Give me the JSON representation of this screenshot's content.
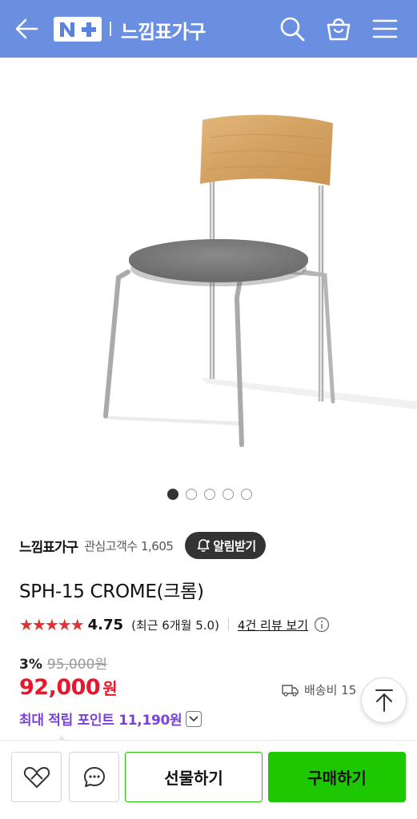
{
  "header": {
    "logo_text": "N+",
    "store_title": "느낌표가구",
    "icons": [
      "back-arrow-icon",
      "search-icon",
      "cart-icon",
      "menu-icon"
    ]
  },
  "gallery": {
    "total_images": 5,
    "current_image": 1
  },
  "store": {
    "name": "느낌표가구",
    "fans_label": "관심고객수 1,605",
    "notify_label": "알림받기"
  },
  "product": {
    "name": "SPH-15 CROME(크롬)",
    "stars": "★★★★★",
    "rating": "4.75",
    "recent_rating": "(최근 6개월 5.0)",
    "review_link": "4건 리뷰 보기",
    "discount_rate": "3%",
    "original_price": "95,000원",
    "price": "92,000",
    "currency": "원",
    "delivery": "배송비 15",
    "points": "최대 적립 포인트 11,190원"
  },
  "actions": {
    "gift_label": "선물하기",
    "buy_label": "구매하기"
  },
  "colors": {
    "header_bg": "#6a8fe0",
    "price_red": "#e8172c",
    "naver_green": "#1ec800",
    "point_purple": "#7a42d6",
    "star_red": "#e0322f"
  }
}
